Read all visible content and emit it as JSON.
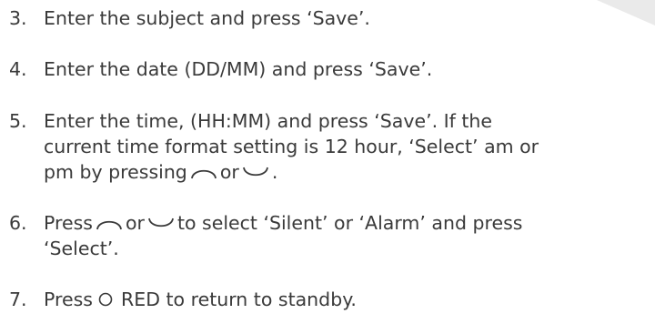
{
  "steps": {
    "s3": {
      "num": "3.",
      "text": "Enter the subject and press ‘Save’."
    },
    "s4": {
      "num": "4.",
      "text": "Enter the date (DD/MM) and press ‘Save’."
    },
    "s5": {
      "num": "5.",
      "line1": "Enter the time, (HH:MM) and press ‘Save’.  If the",
      "line2": "current time format setting is 12 hour, ‘Select’ am or",
      "line3a": "pm by pressing",
      "line3b": "or",
      "line3c": "."
    },
    "s6": {
      "num": "6.",
      "line1a": "Press",
      "line1b": "or",
      "line1c": "to select ‘Silent’ or ‘Alarm’ and press",
      "line2": "‘Select’."
    },
    "s7": {
      "num": "7.",
      "line1a": "Press",
      "line1b": "RED to return to standby."
    }
  },
  "icons": {
    "up": "up-arc-icon",
    "down": "down-arc-icon",
    "red": "red-button-icon"
  }
}
